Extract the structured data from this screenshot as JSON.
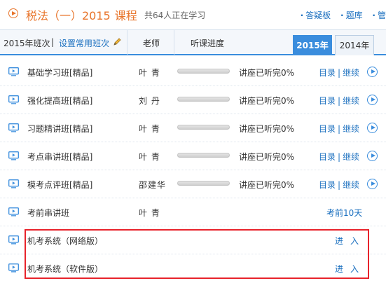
{
  "header": {
    "title": "税法（一）2015",
    "title_sub": "课程",
    "online": "共64人正在学习",
    "links": [
      "答疑板",
      "题库",
      "管"
    ]
  },
  "tabbar": {
    "year_label": "2015年班次",
    "separator": "|",
    "set_common": "设置常用班次",
    "col_teacher": "老师",
    "col_progress": "听课进度",
    "tabs": [
      "2015年",
      "2014年"
    ],
    "active_tab": "2015年"
  },
  "rows": [
    {
      "name": "基础学习班[精品]",
      "teacher": "叶 青",
      "status": "讲座已听完0%",
      "progress": 0,
      "link1": "目录",
      "link2": "继续"
    },
    {
      "name": "强化提高班[精品]",
      "teacher": "刘 丹",
      "status": "讲座已听完0%",
      "progress": 0,
      "link1": "目录",
      "link2": "继续"
    },
    {
      "name": "习题精讲班[精品]",
      "teacher": "叶 青",
      "status": "讲座已听完0%",
      "progress": 0,
      "link1": "目录",
      "link2": "继续"
    },
    {
      "name": "考点串讲班[精品]",
      "teacher": "叶 青",
      "status": "讲座已听完0%",
      "progress": 0,
      "link1": "目录",
      "link2": "继续"
    },
    {
      "name": "模考点评班[精品]",
      "teacher": "邵建华",
      "status": "讲座已听完0%",
      "progress": 0,
      "link1": "目录",
      "link2": "继续"
    },
    {
      "name": "考前串讲班",
      "teacher": "叶 青",
      "countdown": "考前10天"
    },
    {
      "name": "机考系统（网络版）",
      "enter": "进入"
    },
    {
      "name": "机考系统（软件版）",
      "enter": "进入"
    }
  ],
  "colors": {
    "accent_orange": "#e8742a",
    "link_blue": "#1a6fbf",
    "tab_blue": "#3a8ddd",
    "highlight_red": "#e8232b"
  },
  "icons": {
    "header": "play-circle-icon",
    "row": "monitor-icon",
    "row_action": "play-circle-icon",
    "edit": "pencil-icon"
  }
}
